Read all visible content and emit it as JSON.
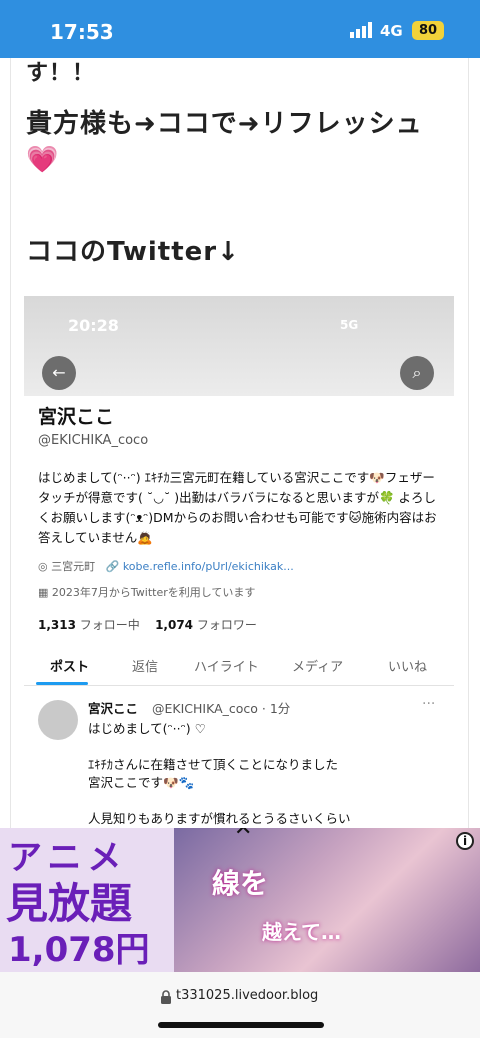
{
  "status": {
    "time": "17:53",
    "network": "4G",
    "battery": "80"
  },
  "article": {
    "line1": "す！！",
    "line2": "貴方様も➜ココで➜リフレッシュ💗",
    "line3": "ココのTwitter↓"
  },
  "tweet_profile": {
    "screenshot_time": "20:28",
    "screenshot_net": "5G",
    "name": "宮沢ここ",
    "handle": "@EKICHIKA_coco",
    "bio": "はじめまして(ᵔ··ᵔ) ｴｷﾁｶ三宮元町在籍している宮沢ここです🐶フェザータッチが得意です( ˘◡˘ )出勤はバラバラになると思いますが🍀 よろしくお願いします(ᵔᴥᵔ)DMからのお問い合わせも可能です🐱施術内容はお答えしていません🙇",
    "location": "三宮元町",
    "link": "kobe.refle.info/pUrl/ekichikak...",
    "joined": "2023年7月からTwitterを利用しています",
    "following_count": "1,313",
    "following_label": "フォロー中",
    "followers_count": "1,074",
    "followers_label": "フォロワー",
    "tabs": [
      "ポスト",
      "返信",
      "ハイライト",
      "メディア",
      "いいね"
    ],
    "tweet": {
      "name": "宮沢ここ",
      "handle": "@EKICHIKA_coco · 1分",
      "lines": [
        "はじめまして(ᵔ··ᵔ) ♡",
        "ｴｷﾁｶさんに在籍させて頂くことになりました",
        "宮沢ここです🐶🐾",
        "人見知りもありますが慣れるとうるさいくらい"
      ]
    }
  },
  "ad": {
    "left_line1": "アニメ",
    "left_line2": "見放題",
    "left_line3": "1,078円",
    "right_line1": "線を",
    "right_line2": "越えて…"
  },
  "urlbar": {
    "url": "t331025.livedoor.blog"
  }
}
